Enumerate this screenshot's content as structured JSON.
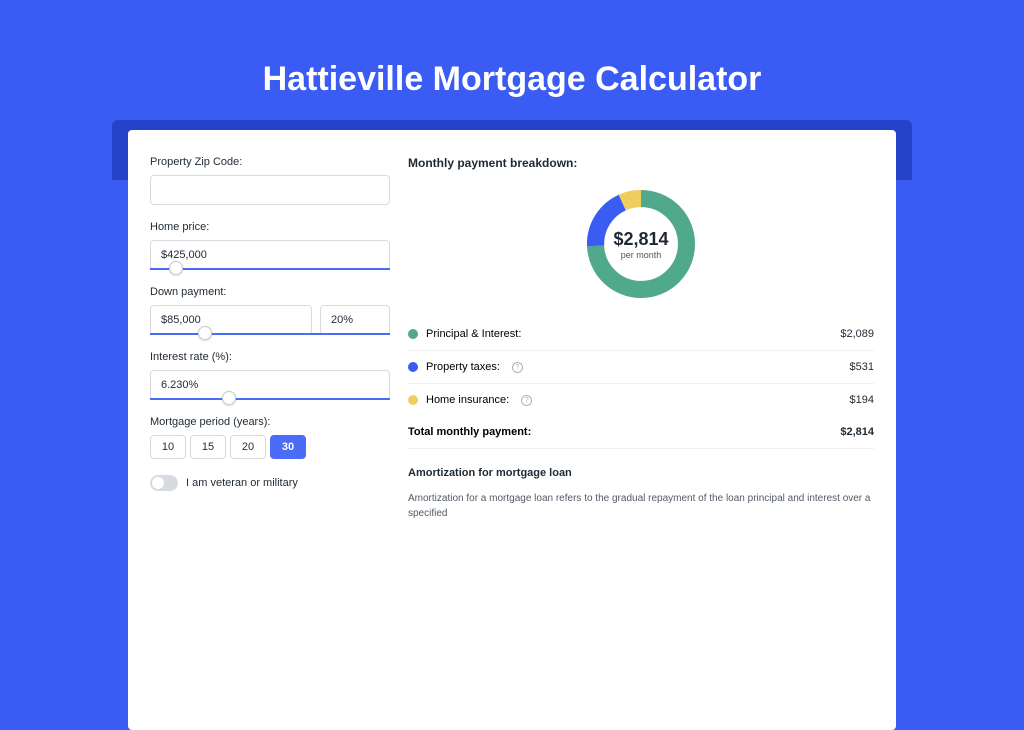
{
  "hero": {
    "title": "Hattieville Mortgage Calculator"
  },
  "form": {
    "zip_label": "Property Zip Code:",
    "zip_value": "",
    "home_price_label": "Home price:",
    "home_price_value": "$425,000",
    "down_payment_label": "Down payment:",
    "down_payment_amount": "$85,000",
    "down_payment_pct": "20%",
    "interest_label": "Interest rate (%):",
    "interest_value": "6.230%",
    "period_label": "Mortgage period (years):",
    "period_options": [
      "10",
      "15",
      "20",
      "30"
    ],
    "period_selected": "30",
    "veteran_label": "I am veteran or military"
  },
  "breakdown": {
    "title": "Monthly payment breakdown:",
    "total_value": "$2,814",
    "total_sub": "per month",
    "items": [
      {
        "label": "Principal & Interest:",
        "value": "$2,089",
        "color": "#4fa98a",
        "info": false
      },
      {
        "label": "Property taxes:",
        "value": "$531",
        "color": "#3b5bf5",
        "info": true
      },
      {
        "label": "Home insurance:",
        "value": "$194",
        "color": "#f0cd5f",
        "info": true
      }
    ],
    "total_label": "Total monthly payment:",
    "total_row_value": "$2,814"
  },
  "amort": {
    "title": "Amortization for mortgage loan",
    "text": "Amortization for a mortgage loan refers to the gradual repayment of the loan principal and interest over a specified"
  },
  "chart_data": {
    "type": "pie",
    "title": "Monthly payment breakdown",
    "series": [
      {
        "name": "Principal & Interest",
        "value": 2089,
        "color": "#4fa98a"
      },
      {
        "name": "Property taxes",
        "value": 531,
        "color": "#3b5bf5"
      },
      {
        "name": "Home insurance",
        "value": 194,
        "color": "#f0cd5f"
      }
    ],
    "total": 2814,
    "center_label": "per month"
  }
}
